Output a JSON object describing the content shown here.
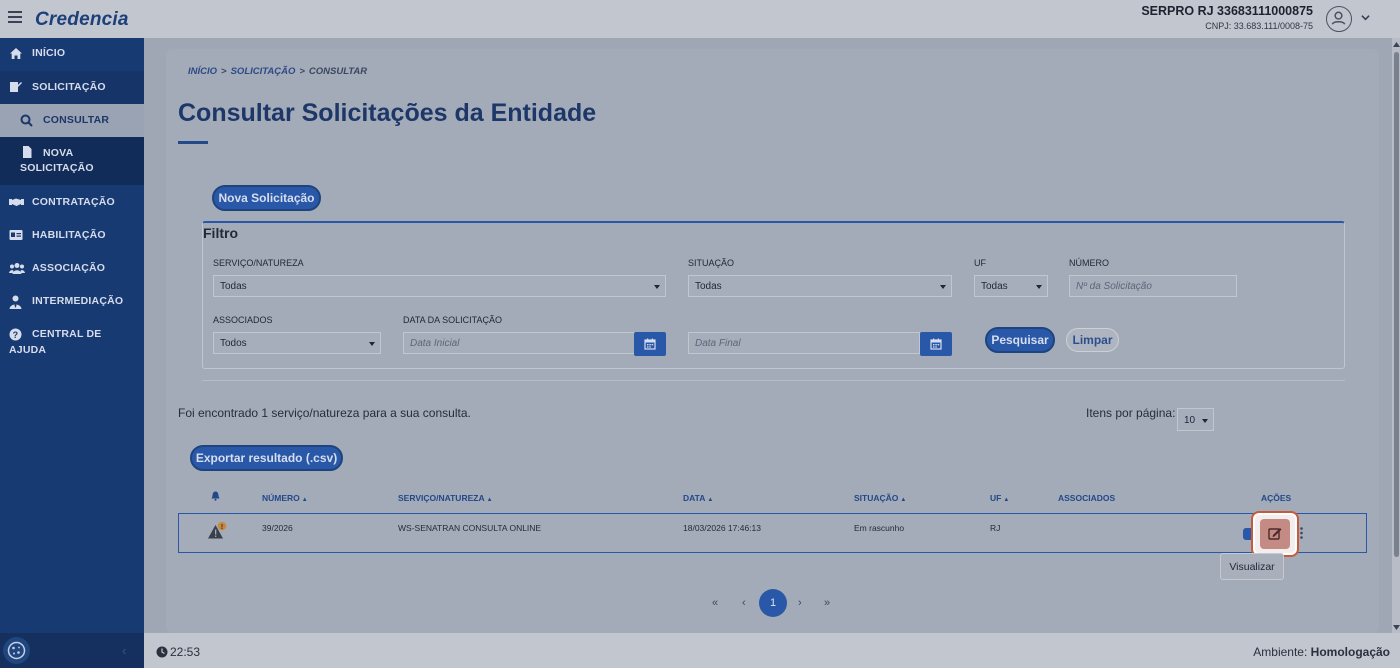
{
  "app": {
    "brand": "Credencia"
  },
  "org": {
    "name": "SERPRO RJ 33683111000875",
    "cnpj": "CNPJ: 33.683.111/0008-75"
  },
  "sidebar": {
    "items": [
      {
        "label": "INÍCIO",
        "icon": "home-icon"
      },
      {
        "label": "SOLICITAÇÃO",
        "icon": "edit-doc-icon"
      },
      {
        "label": "CONSULTAR",
        "icon": "search-icon"
      },
      {
        "label_line1": "NOVA",
        "label_line2": "SOLICITAÇÃO",
        "icon": "file-icon"
      },
      {
        "label": "CONTRATAÇÃO",
        "icon": "handshake-icon"
      },
      {
        "label": "HABILITAÇÃO",
        "icon": "id-card-icon"
      },
      {
        "label": "ASSOCIAÇÃO",
        "icon": "users-icon"
      },
      {
        "label": "INTERMEDIAÇÃO",
        "icon": "person-tie-icon"
      },
      {
        "label_line1": "CENTRAL DE",
        "label_line2": "AJUDA",
        "icon": "question-icon"
      }
    ],
    "collapse": "‹"
  },
  "breadcrumb": {
    "home": "INÍCIO",
    "section": "SOLICITAÇÃO",
    "current": "CONSULTAR",
    "sep": ">"
  },
  "page": {
    "title": "Consultar Solicitações da Entidade"
  },
  "actions": {
    "new_request": "Nova Solicitação",
    "export": "Exportar resultado (.csv)"
  },
  "filter": {
    "title": "Filtro",
    "service_label": "SERVIÇO/NATUREZA",
    "service_value": "Todas",
    "status_label": "SITUAÇÃO",
    "status_value": "Todas",
    "uf_label": "UF",
    "uf_value": "Todas",
    "number_label": "NÚMERO",
    "number_placeholder": "Nº da Solicitação",
    "associates_label": "ASSOCIADOS",
    "associates_value": "Todos",
    "date_label": "DATA DA SOLICITAÇÃO",
    "date_start_placeholder": "Data Inicial",
    "date_end_placeholder": "Data Final",
    "search_button": "Pesquisar",
    "clear_button": "Limpar"
  },
  "results": {
    "summary": "Foi encontrado 1 serviço/natureza para a sua consulta.",
    "per_page_label": "Itens por página:",
    "per_page_value": "10"
  },
  "table": {
    "headers": {
      "number": "NÚMERO",
      "service": "SERVIÇO/NATUREZA",
      "date": "DATA",
      "status": "SITUAÇÃO",
      "uf": "UF",
      "associates": "ASSOCIADOS",
      "actions": "AÇÕES"
    },
    "rows": [
      {
        "number": "39/2026",
        "service": "WS-SENATRAN CONSULTA ONLINE",
        "date": "18/03/2026 17:46:13",
        "status": "Em rascunho",
        "uf": "RJ",
        "associates": "",
        "alert_badge": "!"
      }
    ],
    "tooltip": "Visualizar"
  },
  "pagination": {
    "first": "«",
    "prev": "‹",
    "current": "1",
    "next": "›",
    "last": "»"
  },
  "footer": {
    "time": "22:53",
    "env_label": "Ambiente:",
    "env_value": "Homologação"
  },
  "colors": {
    "primary": "#2a58a8",
    "sidebar": "#183a72",
    "highlight": "#c75a3b"
  }
}
